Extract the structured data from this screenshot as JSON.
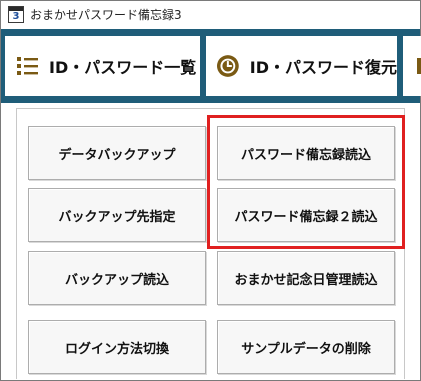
{
  "window": {
    "title": "おまかせパスワード備忘録3",
    "icon_number": "3"
  },
  "toolbar": {
    "buttons": [
      {
        "label": "ID・パスワード一覧",
        "icon": "list-icon"
      },
      {
        "label": "ID・パスワード復元",
        "icon": "restore-clock-icon"
      },
      {
        "label": "",
        "icon": "partial-icon"
      }
    ]
  },
  "actions": {
    "data_backup": "データバックアップ",
    "read_password_book": "パスワード備忘録読込",
    "backup_destination": "バックアップ先指定",
    "read_password_book_2": "パスワード備忘録２読込",
    "read_backup": "バックアップ読込",
    "read_anniversary": "おまかせ記念日管理読込",
    "switch_login_method": "ログイン方法切換",
    "delete_sample_data": "サンプルデータの削除"
  },
  "colors": {
    "toolbar_bg": "#1f5d79",
    "highlight": "#e02020",
    "list_icon": "#7a5a14",
    "restore_icon": "#7a5a14"
  }
}
